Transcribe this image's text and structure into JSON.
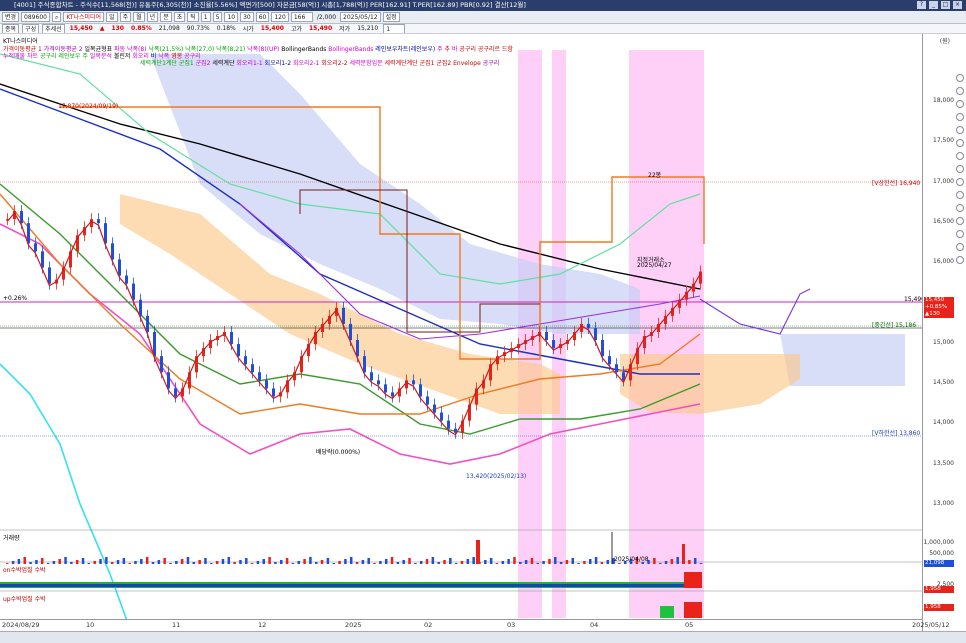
{
  "window": {
    "title": "[4001] 주식종합차트 - 주식수[11,568(천)] 유통주[6,305(천)] 소진율[5.56%] 액면가[500] 자본금[58(억)] 시총[1,788(억)] PER[162.91] T.PER[162.89] PBR[0.92] 결산[12월]",
    "controls": [
      "?",
      "_",
      "□",
      "×"
    ]
  },
  "toolbar": {
    "mode_btn": "변경",
    "code": "089600",
    "name_chip": "KT나스미디어",
    "period_btns": [
      "일",
      "주",
      "월",
      "년",
      "분",
      "초",
      "틱"
    ],
    "minute_btns": [
      "1",
      "5",
      "10",
      "30",
      "60",
      "120"
    ],
    "sel_count": "166",
    "zoom": "/2,000",
    "date": "2025/05/12",
    "settings": "설정",
    "price": "15,450",
    "change_arrow": "▲",
    "change": "130",
    "change_pct": "0.85%",
    "volume": "21,098",
    "volume_pct": "90.73%",
    "turnover": "0.18%",
    "open_label": "시가",
    "open": "15,400",
    "high_label": "고가",
    "high": "15,490",
    "low_label": "저가",
    "low": "15,210",
    "page": "1"
  },
  "toolbar2": {
    "items": [
      "종목",
      "구성",
      "추세선"
    ]
  },
  "legend": {
    "stock_name": "KT나스미디어",
    "row1": [
      "가격이동평균 1",
      "가격이동평균 2",
      "일목균형표",
      "파동",
      "낙폭(8)",
      "낙폭(21,5%)",
      "낙폭(27,0)",
      "낙폭(8,21)",
      "낙폭(8)(UP)",
      "BollingerBands",
      "BollingerBands",
      "레인보우차트(레인보우)",
      "주",
      "추",
      "바",
      "공구리",
      "공구리르",
      "드함"
    ],
    "row2": [
      "누적매물",
      "차트",
      "공구리",
      "레인보우",
      "주",
      "일목분석",
      "볼린저",
      "회오리",
      "비",
      "낙폭",
      "영봉",
      "공구리"
    ],
    "row3": [
      "세력계단1계단",
      "군집1",
      "군집2",
      "세력계단",
      "회오리1-1",
      "회오리1-2",
      "회오리2-1",
      "회오리2-2",
      "세력분함입문",
      "세력계단계단",
      "군집1",
      "군집2",
      "Envelope",
      "공구리"
    ]
  },
  "annotations": {
    "peak": "17,870(2024/09/19)",
    "dividend": "배당락(0.000%)",
    "low": "13,420(2025/02/13)",
    "vol_mark": "2025/04/08",
    "pre_label": "지정거래소",
    "pre_date": "2025/04/27",
    "top_box": "22봉",
    "pct_left": "+0.26%",
    "v_upper": "[V상한선] 16,940",
    "v_mid": "[중간선] 15,186",
    "v_lower": "[V하한선] 13,860",
    "price_line": "15,490",
    "price_boxes": [
      "15,450",
      "+0.85%",
      "▲130"
    ]
  },
  "axis": {
    "unit": "(원)",
    "ticks": [
      "18,000",
      "17,500",
      "17,000",
      "16,500",
      "16,000",
      "15,500",
      "15,000",
      "14,500",
      "14,000",
      "13,500",
      "13,000"
    ],
    "x_labels": [
      "2024/08/29",
      "10",
      "11",
      "12",
      "2025",
      "02",
      "03",
      "04",
      "05",
      "2025/05/12"
    ],
    "vol_ticks": [
      "1,000,000",
      "500,000"
    ],
    "vol_box": "21,098",
    "obv_ticks": [
      "2,500"
    ],
    "obv_box": "1,958",
    "up_box": "1,958"
  },
  "panels": {
    "volume": "거래량",
    "obv": "on수박업질 수박",
    "up": "up수박업질 수박"
  },
  "colors": {
    "titlebar": "#2b3d6b",
    "up": "#e8231a",
    "down": "#1f4fd8",
    "ichimoku_cloud": "#c8cff5",
    "cloud_orange": "#fcc88a",
    "highlight": "#ffb7f3"
  }
}
